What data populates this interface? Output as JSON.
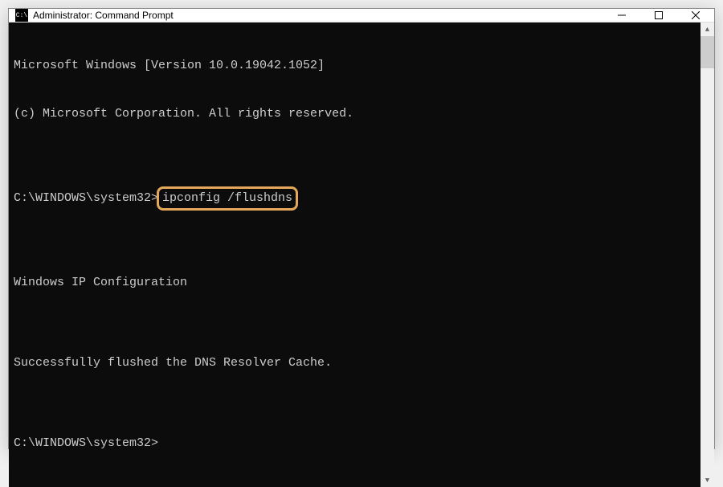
{
  "titlebar": {
    "icon_label": "C:\\",
    "title": "Administrator: Command Prompt"
  },
  "terminal": {
    "line1": "Microsoft Windows [Version 10.0.19042.1052]",
    "line2": "(c) Microsoft Corporation. All rights reserved.",
    "prompt1_prefix": "C:\\WINDOWS\\system32>",
    "prompt1_command": "ipconfig /flushdns",
    "line_blank": "",
    "line3": "Windows IP Configuration",
    "line4": "Successfully flushed the DNS Resolver Cache.",
    "prompt2": "C:\\WINDOWS\\system32>"
  }
}
